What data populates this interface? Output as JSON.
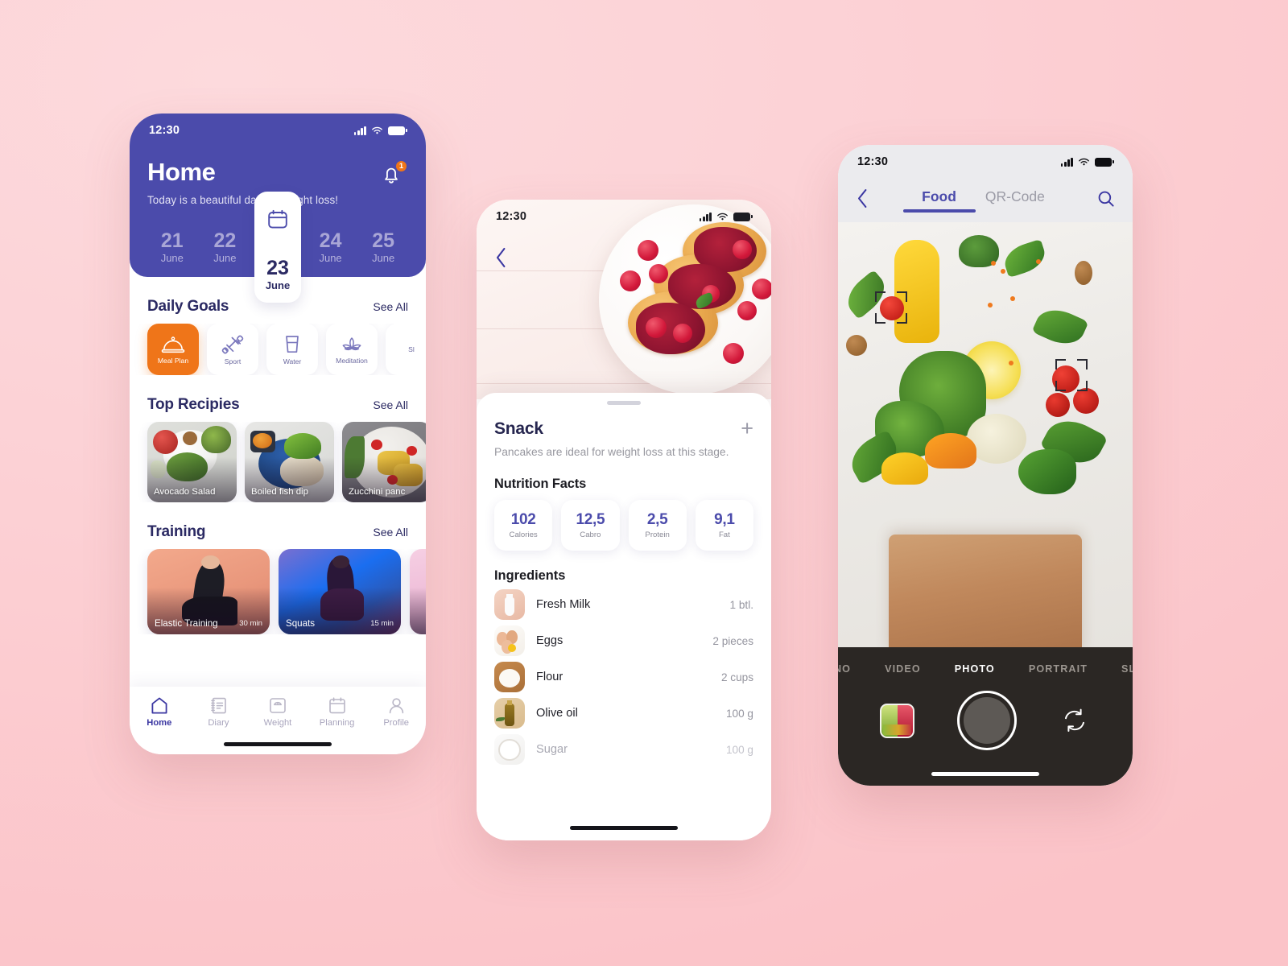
{
  "background_color": "#fbd2d6",
  "accent_purple": "#4b4bab",
  "accent_orange": "#ef7519",
  "phone_home": {
    "status": {
      "time": "12:30",
      "signal_icon": "cellular-signal-icon",
      "wifi_icon": "wifi-icon",
      "battery_icon": "battery-icon"
    },
    "title": "Home",
    "subtitle": "Today is a beautiful day for weight loss!",
    "notification_icon": "bell-icon",
    "notification_count": "1",
    "calendar_icon": "calendar-icon",
    "dates": [
      {
        "day": "21",
        "month": "June",
        "active": false
      },
      {
        "day": "22",
        "month": "June",
        "active": false
      },
      {
        "day": "23",
        "month": "June",
        "active": true
      },
      {
        "day": "24",
        "month": "June",
        "active": false
      },
      {
        "day": "25",
        "month": "June",
        "active": false
      }
    ],
    "daily_goals": {
      "title": "Daily Goals",
      "see_all": "See All",
      "items": [
        {
          "label": "Meal Plan",
          "icon": "cloche-food-cover-icon",
          "active": true
        },
        {
          "label": "Sport",
          "icon": "dumbbell-icon",
          "active": false
        },
        {
          "label": "Water",
          "icon": "water-glass-icon",
          "active": false
        },
        {
          "label": "Meditation",
          "icon": "lotus-flower-icon",
          "active": false
        },
        {
          "label": "Sl",
          "icon": "sleep-icon",
          "active": false
        }
      ]
    },
    "top_recipes": {
      "title": "Top Recipies",
      "see_all": "See All",
      "items": [
        {
          "label": "Avocado Salad"
        },
        {
          "label": "Boiled fish dip"
        },
        {
          "label": "Zucchini panc"
        }
      ]
    },
    "training": {
      "title": "Training",
      "see_all": "See All",
      "items": [
        {
          "label": "Elastic Training",
          "duration": "30 min"
        },
        {
          "label": "Squats",
          "duration": "15 min"
        },
        {
          "label": "",
          "duration": ""
        }
      ]
    },
    "tabbar": [
      {
        "label": "Home",
        "icon": "home-icon",
        "active": true
      },
      {
        "label": "Diary",
        "icon": "notebook-icon",
        "active": false
      },
      {
        "label": "Weight",
        "icon": "scale-icon",
        "active": false
      },
      {
        "label": "Planning",
        "icon": "calendar-icon",
        "active": false
      },
      {
        "label": "Profile",
        "icon": "person-icon",
        "active": false
      }
    ]
  },
  "phone_recipe": {
    "status": {
      "time": "12:30"
    },
    "back_icon": "chevron-left-icon",
    "hero_image_alt": "pancakes-with-raspberry-jam",
    "title": "Snack",
    "add_icon": "plus-icon",
    "description": "Pancakes are ideal for weight loss at this stage.",
    "nutrition_title": "Nutrition Facts",
    "nutrition": [
      {
        "value": "102",
        "label": "Calories"
      },
      {
        "value": "12,5",
        "label": "Cabro"
      },
      {
        "value": "2,5",
        "label": "Protein"
      },
      {
        "value": "9,1",
        "label": "Fat"
      }
    ],
    "ingredients_title": "Ingredients",
    "ingredients": [
      {
        "name": "Fresh Milk",
        "qty": "1 btl.",
        "icon": "milk-bottle-image"
      },
      {
        "name": "Eggs",
        "qty": "2 pieces",
        "icon": "eggs-image"
      },
      {
        "name": "Flour",
        "qty": "2 cups",
        "icon": "flour-image"
      },
      {
        "name": "Olive oil",
        "qty": "100 g",
        "icon": "olive-oil-image"
      },
      {
        "name": "Sugar",
        "qty": "100 g",
        "icon": "sugar-image"
      }
    ]
  },
  "phone_camera": {
    "status": {
      "time": "12:30"
    },
    "back_icon": "chevron-left-icon",
    "search_icon": "search-icon",
    "tabs": [
      {
        "label": "Food",
        "active": true
      },
      {
        "label": "QR-Code",
        "active": false
      }
    ],
    "viewfinder_alt": "vegetables-in-paper-grocery-bag",
    "focus_brackets": 2,
    "modes": [
      {
        "label": "ANO",
        "active": false
      },
      {
        "label": "VIDEO",
        "active": false
      },
      {
        "label": "PHOTO",
        "active": true
      },
      {
        "label": "PORTRAIT",
        "active": false
      },
      {
        "label": "SLO",
        "active": false
      }
    ],
    "gallery_thumb_alt": "smoothie-jars-thumbnail",
    "shutter_label": "shutter-button",
    "flip_icon": "camera-flip-icon"
  }
}
